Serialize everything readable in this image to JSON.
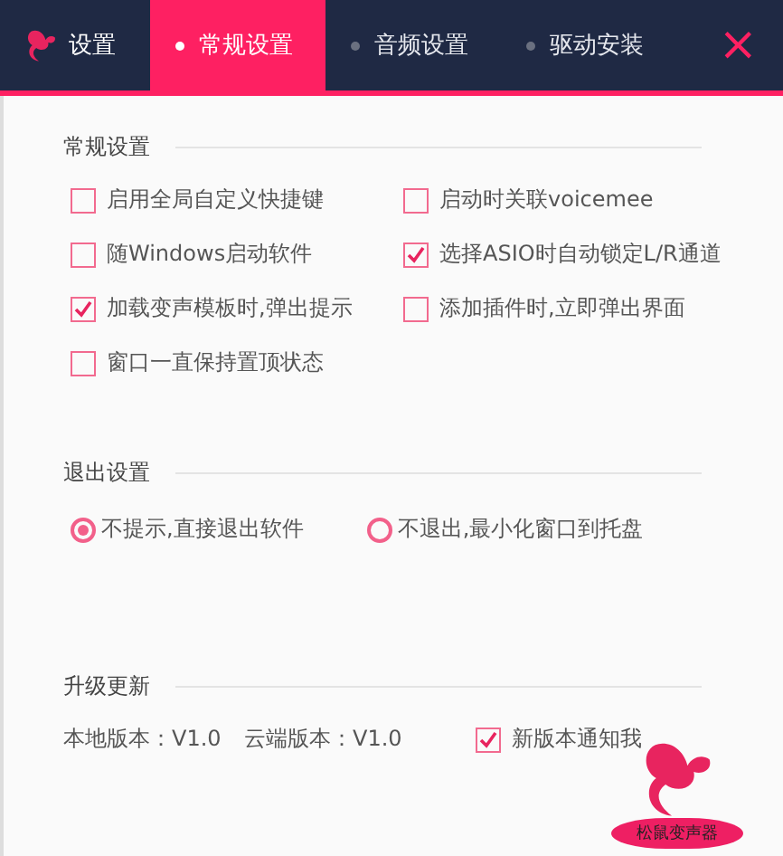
{
  "header": {
    "brand": "设置",
    "tabs": [
      {
        "label": "常规设置",
        "selected": true
      },
      {
        "label": "音频设置",
        "selected": false
      },
      {
        "label": "驱动安装",
        "selected": false
      }
    ],
    "close": "×"
  },
  "general": {
    "title": "常规设置",
    "options": [
      {
        "label": "启用全局自定义快捷键",
        "checked": false
      },
      {
        "label": "启动时关联voicemee",
        "checked": false
      },
      {
        "label": "随Windows启动软件",
        "checked": false
      },
      {
        "label": "选择ASIO时自动锁定L/R通道",
        "checked": true
      },
      {
        "label": "加载变声模板时,弹出提示",
        "checked": true
      },
      {
        "label": "添加插件时,立即弹出界面",
        "checked": false
      },
      {
        "label": "窗口一直保持置顶状态",
        "checked": false
      }
    ]
  },
  "exit": {
    "title": "退出设置",
    "options": [
      {
        "label": "不提示,直接退出软件",
        "selected": true
      },
      {
        "label": "不退出,最小化窗口到托盘",
        "selected": false
      }
    ]
  },
  "update": {
    "title": "升级更新",
    "local_version": "本地版本：V1.0",
    "cloud_version": "云端版本：V1.0",
    "notify": {
      "label": "新版本通知我",
      "checked": true
    }
  },
  "logo_caption": "松鼠变声器"
}
